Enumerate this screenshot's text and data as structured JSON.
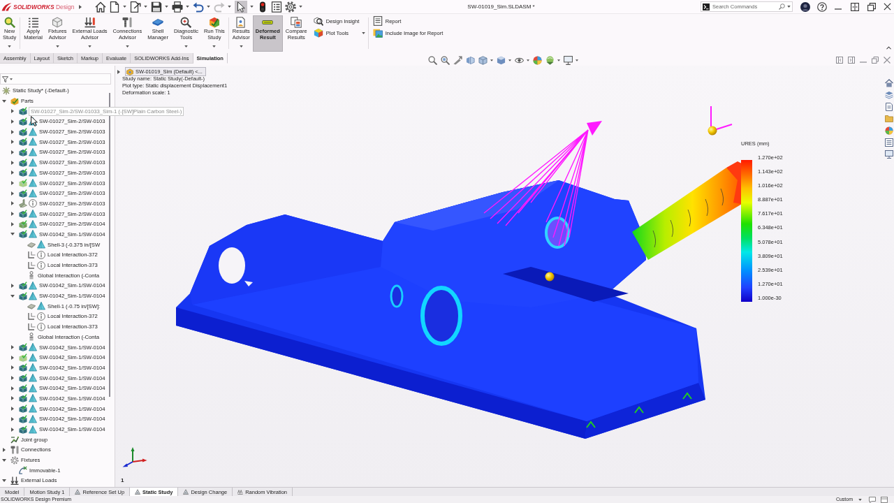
{
  "app": {
    "logo": "**SOLIDWORKS** Design"
  },
  "quick_access": [
    {
      "kind": "home",
      "dropdown": false,
      "selected": false,
      "disabled": false
    },
    {
      "kind": "new",
      "dropdown": true,
      "selected": false,
      "disabled": false
    },
    {
      "kind": "open",
      "dropdown": true,
      "selected": false,
      "disabled": false
    },
    {
      "kind": "save",
      "dropdown": true,
      "selected": false,
      "disabled": false
    },
    {
      "kind": "print",
      "dropdown": true,
      "selected": false,
      "disabled": false
    },
    {
      "kind": "undo",
      "dropdown": true,
      "selected": false,
      "disabled": false
    },
    {
      "kind": "redo",
      "dropdown": true,
      "selected": false,
      "disabled": true
    },
    {
      "kind": "select",
      "dropdown": true,
      "selected": true,
      "disabled": false
    },
    {
      "kind": "rebuild",
      "dropdown": false,
      "selected": false,
      "disabled": false
    },
    {
      "kind": "file-properties",
      "dropdown": false,
      "selected": false,
      "disabled": false
    },
    {
      "kind": "options",
      "dropdown": true,
      "selected": false,
      "disabled": false
    }
  ],
  "window": {
    "title": "SW-01019_Sim.SLDASM *"
  },
  "search": {
    "placeholder": "Search Commands"
  },
  "ribbon": {
    "groups": [
      {
        "buttons": [
          {
            "label": "New\nStudy",
            "kind": "new-study",
            "dropdown": true,
            "selected": false
          }
        ]
      },
      {
        "buttons": [
          {
            "label": "Apply\nMaterial",
            "kind": "apply-material",
            "dropdown": false,
            "selected": false
          },
          {
            "label": "Fixtures\nAdvisor",
            "kind": "fixtures-advisor",
            "dropdown": true,
            "selected": false
          },
          {
            "label": "External Loads\nAdvisor",
            "kind": "loads-advisor",
            "dropdown": true,
            "selected": false
          },
          {
            "label": "Connections\nAdvisor",
            "kind": "connections-advisor",
            "dropdown": true,
            "selected": false
          },
          {
            "label": "Shell\nManager",
            "kind": "shell-manager",
            "dropdown": false,
            "selected": false
          },
          {
            "label": "Diagnostic\nTools",
            "kind": "diagnostic-tools",
            "dropdown": true,
            "selected": false
          },
          {
            "label": "Run This\nStudy",
            "kind": "run-study",
            "dropdown": true,
            "selected": false
          }
        ]
      },
      {
        "buttons": [
          {
            "label": "Results\nAdvisor",
            "kind": "results-advisor",
            "dropdown": true,
            "selected": false
          },
          {
            "label": "Deformed\nResult",
            "kind": "deformed-result",
            "dropdown": false,
            "selected": true
          },
          {
            "label": "Compare\nResults",
            "kind": "compare-results",
            "dropdown": false,
            "selected": false
          }
        ],
        "small": [
          {
            "label": "Design Insight",
            "kind": "design-insight",
            "dropdown": false
          },
          {
            "label": "Plot Tools",
            "kind": "plot-tools",
            "dropdown": true
          }
        ]
      },
      {
        "small": [
          {
            "label": "Report",
            "kind": "report",
            "dropdown": false
          },
          {
            "label": "Include Image for Report",
            "kind": "include-image",
            "dropdown": false
          }
        ]
      }
    ]
  },
  "command_tabs": [
    {
      "label": "Assembly",
      "selected": false
    },
    {
      "label": "Layout",
      "selected": false
    },
    {
      "label": "Sketch",
      "selected": false
    },
    {
      "label": "Markup",
      "selected": false
    },
    {
      "label": "Evaluate",
      "selected": false
    },
    {
      "label": "SOLIDWORKS Add-Ins",
      "selected": false
    },
    {
      "label": "Simulation",
      "selected": true
    }
  ],
  "feature_tree": {
    "items": [
      {
        "label": "Static Study* (-Default-)",
        "kind": "study",
        "children": [
          {
            "label": "Parts",
            "kind": "parts",
            "expanded": true,
            "children": [
              {
                "label": "SW-01027_Sim-2/SW-01033_Sim-1 (-[SW]Plain Carbon Steel-)",
                "kind": "part",
                "expanded": false,
                "hovered": true
              },
              {
                "label": "SW-01027_Sim-2/SW-0103",
                "kind": "part",
                "expanded": false,
                "hovered": false
              },
              {
                "label": "SW-01027_Sim-2/SW-0103",
                "kind": "part",
                "expanded": false,
                "hovered": false
              },
              {
                "label": "SW-01027_Sim-2/SW-0103",
                "kind": "part",
                "expanded": false,
                "hovered": false
              },
              {
                "label": "SW-01027_Sim-2/SW-0103",
                "kind": "part",
                "expanded": false,
                "hovered": false
              },
              {
                "label": "SW-01027_Sim-2/SW-0103",
                "kind": "part",
                "expanded": false,
                "hovered": false
              },
              {
                "label": "SW-01027_Sim-2/SW-0103",
                "kind": "part",
                "expanded": false,
                "hovered": false
              },
              {
                "label": "SW-01027_Sim-2/SW-0103",
                "kind": "partlight",
                "expanded": false,
                "hovered": false
              },
              {
                "label": "SW-01027_Sim-2/SW-0103",
                "kind": "part",
                "expanded": false,
                "hovered": false
              },
              {
                "label": "SW-01027_Sim-2/SW-0103",
                "kind": "sheetmetal",
                "expanded": false,
                "hovered": false
              },
              {
                "label": "SW-01027_Sim-2/SW-0103",
                "kind": "part",
                "expanded": false,
                "hovered": false
              },
              {
                "label": "SW-01027_Sim-2/SW-0104",
                "kind": "partgreen",
                "expanded": false,
                "hovered": false
              },
              {
                "label": "SW-01042_Sim-1/SW-0104",
                "kind": "part",
                "expanded": true,
                "hovered": false,
                "children": [
                  {
                    "label": "Shell-3 (-0.375 in/[SW",
                    "kind": "shell"
                  },
                  {
                    "label": "Local Interaction-372",
                    "kind": "local-interaction"
                  },
                  {
                    "label": "Local Interaction-373",
                    "kind": "local-interaction"
                  },
                  {
                    "label": "Global Interaction (-Conta",
                    "kind": "global-interaction"
                  }
                ]
              },
              {
                "label": "SW-01042_Sim-1/SW-0104",
                "kind": "part",
                "expanded": false,
                "hovered": false
              },
              {
                "label": "SW-01042_Sim-1/SW-0104",
                "kind": "part",
                "expanded": true,
                "hovered": false,
                "children": [
                  {
                    "label": "Shell-1 (-0.75 in/[SW]:",
                    "kind": "shell"
                  },
                  {
                    "label": "Local Interaction-372",
                    "kind": "local-interaction"
                  },
                  {
                    "label": "Local Interaction-373",
                    "kind": "local-interaction"
                  },
                  {
                    "label": "Global Interaction (-Conta",
                    "kind": "global-interaction"
                  }
                ]
              },
              {
                "label": "SW-01042_Sim-1/SW-0104",
                "kind": "part",
                "expanded": false,
                "hovered": false
              },
              {
                "label": "SW-01042_Sim-1/SW-0104",
                "kind": "partlight",
                "expanded": false,
                "hovered": false
              },
              {
                "label": "SW-01042_Sim-1/SW-0104",
                "kind": "part",
                "expanded": false,
                "hovered": false
              },
              {
                "label": "SW-01042_Sim-1/SW-0104",
                "kind": "part",
                "expanded": false,
                "hovered": false
              },
              {
                "label": "SW-01042_Sim-1/SW-0104",
                "kind": "part",
                "expanded": false,
                "hovered": false
              },
              {
                "label": "SW-01042_Sim-1/SW-0104",
                "kind": "part",
                "expanded": false,
                "hovered": false
              },
              {
                "label": "SW-01042_Sim-1/SW-0104",
                "kind": "part",
                "expanded": false,
                "hovered": false
              },
              {
                "label": "SW-01042_Sim-1/SW-0104",
                "kind": "part",
                "expanded": false,
                "hovered": false
              },
              {
                "label": "SW-01042_Sim-1/SW-0104",
                "kind": "part",
                "expanded": false,
                "hovered": false
              }
            ]
          },
          {
            "label": "Joint group",
            "kind": "joint-group"
          },
          {
            "label": "Connections",
            "kind": "connections",
            "expanded": false
          },
          {
            "label": "Fixtures",
            "kind": "fixtures",
            "expanded": true,
            "children": [
              {
                "label": "Immovable-1",
                "kind": "fixture"
              }
            ]
          },
          {
            "label": "External Loads",
            "kind": "loads",
            "expanded": true
          }
        ]
      }
    ]
  },
  "viewport": {
    "flyout": "SW-01019_Sim (Default) <...",
    "plot_info": [
      "Study name: Static Study(-Default-)",
      "Plot type: Static displacement Displacement1",
      "Deformation scale: 1"
    ],
    "legend": {
      "title": "URES (mm)",
      "values": [
        "1.270e+02",
        "1.143e+02",
        "1.016e+02",
        "8.887e+01",
        "7.617e+01",
        "6.348e+01",
        "5.078e+01",
        "3.809e+01",
        "2.539e+01",
        "1.270e+01",
        "1.000e-30"
      ]
    },
    "view_number": "1"
  },
  "bottom_tabs": [
    {
      "label": "Model",
      "kind": "model",
      "selected": false
    },
    {
      "label": "Motion Study 1",
      "kind": "motion",
      "selected": false
    },
    {
      "label": "Reference Set Up",
      "kind": "study",
      "selected": false
    },
    {
      "label": "Static Study",
      "kind": "study",
      "selected": true
    },
    {
      "label": "Design Change",
      "kind": "study",
      "selected": false
    },
    {
      "label": "Random Vibration",
      "kind": "vibration",
      "selected": false
    }
  ],
  "status_bar": {
    "text": "SOLIDWORKS Design Premium",
    "units": "Custom"
  }
}
